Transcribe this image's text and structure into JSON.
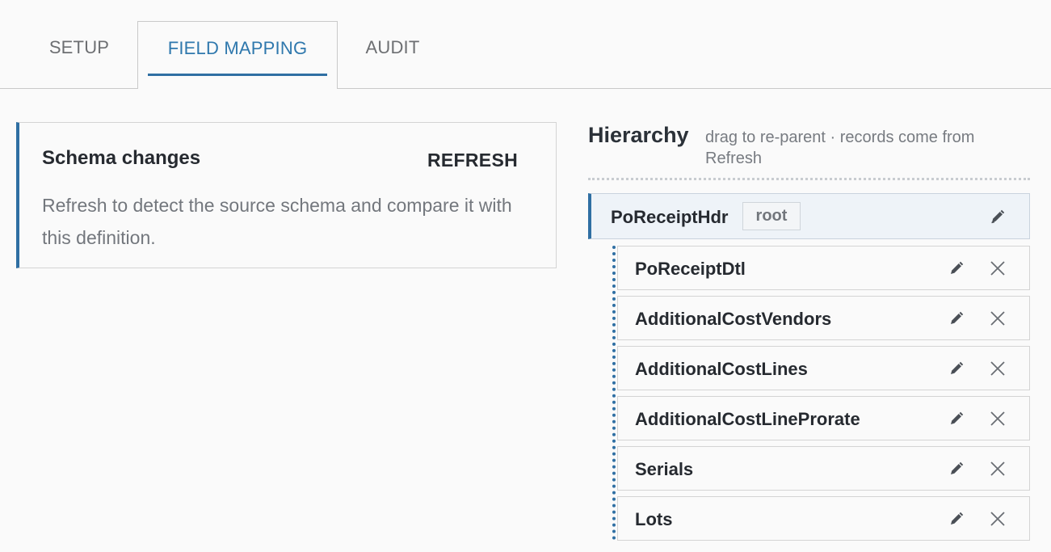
{
  "tabs": [
    {
      "label": "SETUP",
      "active": false
    },
    {
      "label": "FIELD MAPPING",
      "active": true
    },
    {
      "label": "AUDIT",
      "active": false
    }
  ],
  "schema": {
    "title": "Schema changes",
    "refresh_label": "REFRESH",
    "description": "Refresh to detect the source schema and compare it with this definition."
  },
  "hierarchy": {
    "title": "Hierarchy",
    "hint": "drag to re-parent · records come from Refresh",
    "root": {
      "name": "PoReceiptHdr",
      "badge": "root",
      "edit_icon": "pencil-icon"
    },
    "children": [
      {
        "name": "PoReceiptDtl"
      },
      {
        "name": "AdditionalCostVendors"
      },
      {
        "name": "AdditionalCostLines"
      },
      {
        "name": "AdditionalCostLineProrate"
      },
      {
        "name": "Serials"
      },
      {
        "name": "Lots"
      }
    ],
    "child_icons": {
      "edit": "pencil-icon",
      "remove": "close-icon"
    }
  },
  "colors": {
    "accent": "#2f6fa3",
    "active_tab_text": "#2f78ad",
    "root_bg": "#eef3f8"
  }
}
